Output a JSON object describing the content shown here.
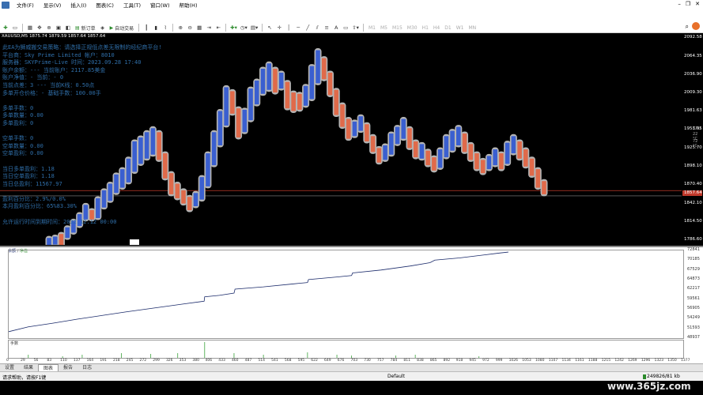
{
  "menu": {
    "items": [
      "文件(F)",
      "显示(V)",
      "插入(I)",
      "图表(C)",
      "工具(T)",
      "窗口(W)",
      "帮助(H)"
    ]
  },
  "toolbar": {
    "new_order_label": "新订单",
    "autotrade_label": "自动交易",
    "timeframes": [
      "M1",
      "M5",
      "M15",
      "M30",
      "H1",
      "H4",
      "D1",
      "W1",
      "MN"
    ]
  },
  "chart": {
    "title": "XAUUSD,M5",
    "ohlc": "1875.74 1879.59 1857.64 1857.64",
    "ea_info": [
      "此EA为狮威搬交易策略：请选择正规低点差无限制的经纪商平台!",
      "平台商：Sky Prime Limited 帐户：8010",
      "服务器：SKYPrime-Live 时间：2023.09.28 17:40",
      "账户余额：--- 当前账户：2117.85美金",
      "账户净值：- 当前：- 0",
      "当前点差：3 --- 当前K线：0.50点",
      "多单开仓价格：-    基础手数：100.00手",
      "",
      "多单手数：0",
      "多单数量：0.00",
      "多单盈利：0",
      "",
      "空单手数：0",
      "空单数量：0.00",
      "空单盈利：0.00",
      "",
      "当日多单盈利：1.18",
      "当日空单盈利：1.18",
      "当日总盈利：11567.97",
      "",
      "盈利百分比：2.9%/0.0%",
      "本月盈利百分比：65%83.30%",
      "",
      "允许运行时间到期时间：2032.12.12 00:00"
    ],
    "candles": [
      [
        "u",
        1768,
        1790
      ],
      [
        "u",
        1780,
        1792
      ],
      [
        "d",
        1776,
        1796
      ],
      [
        "u",
        1790,
        1806
      ],
      [
        "u",
        1798,
        1816
      ],
      [
        "u",
        1808,
        1826
      ],
      [
        "u",
        1818,
        1840
      ],
      [
        "d",
        1818,
        1832
      ],
      [
        "u",
        1820,
        1850
      ],
      [
        "u",
        1836,
        1862
      ],
      [
        "u",
        1846,
        1872
      ],
      [
        "u",
        1858,
        1886
      ],
      [
        "u",
        1866,
        1894
      ],
      [
        "u",
        1874,
        1910
      ],
      [
        "u",
        1890,
        1936
      ],
      [
        "u",
        1902,
        1942
      ],
      [
        "u",
        1910,
        1950
      ],
      [
        "u",
        1916,
        1956
      ],
      [
        "d",
        1908,
        1950
      ],
      [
        "d",
        1880,
        1918
      ],
      [
        "d",
        1856,
        1888
      ],
      [
        "d",
        1850,
        1872
      ],
      [
        "d",
        1842,
        1862
      ],
      [
        "d",
        1832,
        1852
      ],
      [
        "u",
        1838,
        1858
      ],
      [
        "u",
        1848,
        1882
      ],
      [
        "u",
        1868,
        1918
      ],
      [
        "u",
        1900,
        1950
      ],
      [
        "u",
        1930,
        1982
      ],
      [
        "u",
        1960,
        2018
      ],
      [
        "d",
        1978,
        2012
      ],
      [
        "d",
        1942,
        1986
      ],
      [
        "u",
        1950,
        1984
      ],
      [
        "u",
        1968,
        2016
      ],
      [
        "u",
        1992,
        2028
      ],
      [
        "u",
        2008,
        2046
      ],
      [
        "u",
        2014,
        2054
      ],
      [
        "d",
        2010,
        2046
      ],
      [
        "u",
        2016,
        2040
      ],
      [
        "d",
        1986,
        2026
      ],
      [
        "d",
        1982,
        2010
      ],
      [
        "d",
        1984,
        2008
      ],
      [
        "u",
        1990,
        2020
      ],
      [
        "u",
        2000,
        2050
      ],
      [
        "u",
        2024,
        2074
      ],
      [
        "d",
        2030,
        2062
      ],
      [
        "d",
        2006,
        2040
      ],
      [
        "d",
        1976,
        2014
      ],
      [
        "d",
        1958,
        1992
      ],
      [
        "d",
        1940,
        1970
      ],
      [
        "u",
        1944,
        1966
      ],
      [
        "u",
        1952,
        1974
      ],
      [
        "d",
        1936,
        1962
      ],
      [
        "d",
        1920,
        1944
      ],
      [
        "d",
        1904,
        1926
      ],
      [
        "u",
        1908,
        1930
      ],
      [
        "u",
        1916,
        1948
      ],
      [
        "u",
        1932,
        1958
      ],
      [
        "u",
        1940,
        1970
      ],
      [
        "d",
        1926,
        1956
      ],
      [
        "d",
        1912,
        1936
      ],
      [
        "u",
        1910,
        1932
      ],
      [
        "d",
        1900,
        1922
      ],
      [
        "d",
        1892,
        1912
      ],
      [
        "u",
        1896,
        1924
      ],
      [
        "u",
        1912,
        1944
      ],
      [
        "u",
        1922,
        1952
      ],
      [
        "u",
        1930,
        1958
      ],
      [
        "d",
        1920,
        1948
      ],
      [
        "d",
        1908,
        1932
      ],
      [
        "d",
        1894,
        1918
      ],
      [
        "d",
        1888,
        1908
      ],
      [
        "u",
        1894,
        1914
      ],
      [
        "u",
        1900,
        1924
      ],
      [
        "d",
        1894,
        1918
      ],
      [
        "u",
        1902,
        1934
      ],
      [
        "u",
        1918,
        1944
      ],
      [
        "d",
        1910,
        1936
      ],
      [
        "d",
        1898,
        1924
      ],
      [
        "d",
        1884,
        1910
      ],
      [
        "d",
        1866,
        1894
      ],
      [
        "d",
        1856,
        1876
      ]
    ],
    "colors": {
      "bull": "#3a5fd0",
      "bear": "#e06a4a",
      "halo": "#b4b4b4",
      "price_line": "#c0392b"
    }
  },
  "price_axis": {
    "labels": [
      "2092.58",
      "2064.35",
      "2036.90",
      "2009.30",
      "1981.63",
      "1953.95",
      "1925.70",
      "1898.10",
      "1870.40",
      "1842.10",
      "1814.50",
      "1786.60"
    ],
    "label_values": [
      2092.58,
      2064.35,
      2036.9,
      2009.3,
      1981.63,
      1953.95,
      1925.7,
      1898.1,
      1870.4,
      1842.1,
      1814.5,
      1786.6
    ],
    "current_price": "1857.64",
    "current_value": 1857.64,
    "extras": [
      "CPU",
      "22 °C",
      "72 °C"
    ]
  },
  "tester": {
    "graph_label": "余额",
    "graph_label_2": "净值",
    "y_labels": [
      "72841",
      "70185",
      "67529",
      "64873",
      "62217",
      "59561",
      "56905",
      "54249",
      "51593",
      "48937"
    ],
    "volume_label": "手数",
    "x_labels": [
      "0",
      "29",
      "56",
      "83",
      "110",
      "137",
      "164",
      "191",
      "218",
      "245",
      "272",
      "299",
      "326",
      "353",
      "380",
      "406",
      "433",
      "460",
      "487",
      "514",
      "541",
      "568",
      "595",
      "622",
      "649",
      "676",
      "703",
      "730",
      "757",
      "784",
      "811",
      "838",
      "865",
      "892",
      "918",
      "945",
      "972",
      "999",
      "1026",
      "1053",
      "1080",
      "1107",
      "1134",
      "1161",
      "1188",
      "1215",
      "1242",
      "1269",
      "1296",
      "1323",
      "1350",
      "1377"
    ],
    "balance_curve": [
      [
        0,
        50700
      ],
      [
        40,
        52000
      ],
      [
        90,
        53000
      ],
      [
        140,
        54100
      ],
      [
        190,
        55100
      ],
      [
        240,
        56100
      ],
      [
        300,
        57200
      ],
      [
        360,
        58300
      ],
      [
        399,
        59000
      ],
      [
        400,
        60200
      ],
      [
        430,
        60600
      ],
      [
        460,
        61200
      ],
      [
        462,
        62300
      ],
      [
        520,
        62900
      ],
      [
        580,
        63700
      ],
      [
        610,
        64100
      ],
      [
        612,
        64900
      ],
      [
        670,
        65600
      ],
      [
        700,
        66000
      ],
      [
        702,
        66700
      ],
      [
        760,
        67500
      ],
      [
        820,
        68600
      ],
      [
        860,
        69500
      ],
      [
        870,
        70200
      ],
      [
        920,
        70800
      ],
      [
        970,
        71600
      ],
      [
        1000,
        72100
      ],
      [
        1020,
        72400
      ]
    ],
    "volume_spikes": [
      [
        40,
        0.2
      ],
      [
        110,
        0.1
      ],
      [
        150,
        0.2
      ],
      [
        230,
        0.3
      ],
      [
        290,
        0.25
      ],
      [
        345,
        0.3
      ],
      [
        400,
        1.0
      ],
      [
        460,
        0.3
      ],
      [
        520,
        0.2
      ],
      [
        610,
        0.35
      ],
      [
        670,
        0.2
      ],
      [
        700,
        0.15
      ],
      [
        790,
        0.15
      ],
      [
        830,
        0.2
      ],
      [
        960,
        0.1
      ]
    ],
    "tabs": [
      "设置",
      "结果",
      "图表",
      "报告",
      "日志"
    ],
    "active_tab": "图表"
  },
  "status": {
    "left": "请求帮助，请按F1键",
    "middle": "Default",
    "right": "249826/81 kb"
  },
  "watermark": "www.365jz.com"
}
